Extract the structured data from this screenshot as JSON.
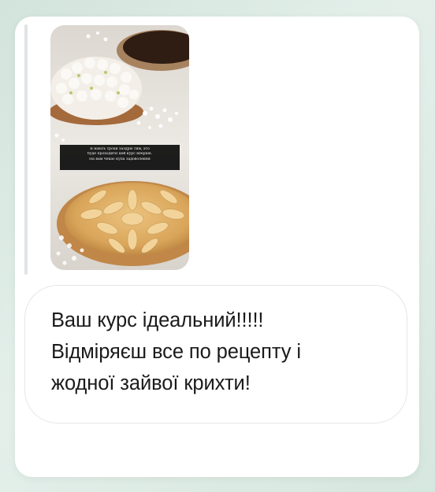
{
  "story_reply": {
    "story_caption_lines": [
      "Я навіть трохи заздрю тим, хто",
      "буде проходити цей курс вперше.",
      "На вам чекає купа задоволення"
    ]
  },
  "message": {
    "lines": [
      "Ваш курс ідеальний!!!!!",
      "Відміряєш все по рецепту і",
      "жодної зайвої крихти!"
    ]
  },
  "colors": {
    "page_background": "#d9e8e1",
    "card_background": "#ffffff",
    "bubble_border": "#e5e6e9",
    "text": "#1a1a1a"
  }
}
